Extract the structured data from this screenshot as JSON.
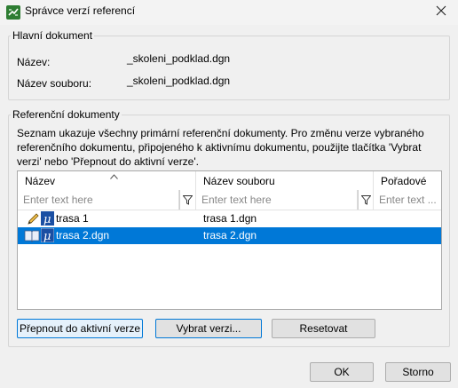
{
  "window": {
    "title": "Správce verzí referencí",
    "icon": "app-icon",
    "close_icon": "close-icon"
  },
  "main_doc": {
    "legend": "Hlavní dokument",
    "name_label": "Název:",
    "name_value": "_skoleni_podklad.dgn",
    "file_label": "Název souboru:",
    "file_value": "_skoleni_podklad.dgn"
  },
  "ref_docs": {
    "legend": "Referenční dokumenty",
    "description": "Seznam ukazuje všechny primární referenční dokumenty. Pro změnu verze vybraného referenčního dokumentu, připojeného k aktivnímu dokumentu, použijte tlačítka 'Vybrat verzi' nebo 'Přepnout do aktivní verze'.",
    "columns": [
      "Název",
      "Název souboru",
      "Pořadové"
    ],
    "filter_placeholder": "Enter text here",
    "filter_placeholder_partial": "Enter text ...",
    "rows": [
      {
        "name": "trasa 1",
        "file": "trasa 1.dgn",
        "icon": "pencil-icon",
        "selected": false
      },
      {
        "name": "trasa 2.dgn",
        "file": "trasa 2.dgn",
        "icon": "book-icon",
        "selected": true
      }
    ]
  },
  "buttons": {
    "switch_active": "Přepnout do aktivní verze",
    "select_version": "Vybrat verzi...",
    "reset": "Resetovat",
    "ok": "OK",
    "cancel": "Storno"
  },
  "colors": {
    "selection": "#0078d7",
    "accent": "#0078d7"
  }
}
